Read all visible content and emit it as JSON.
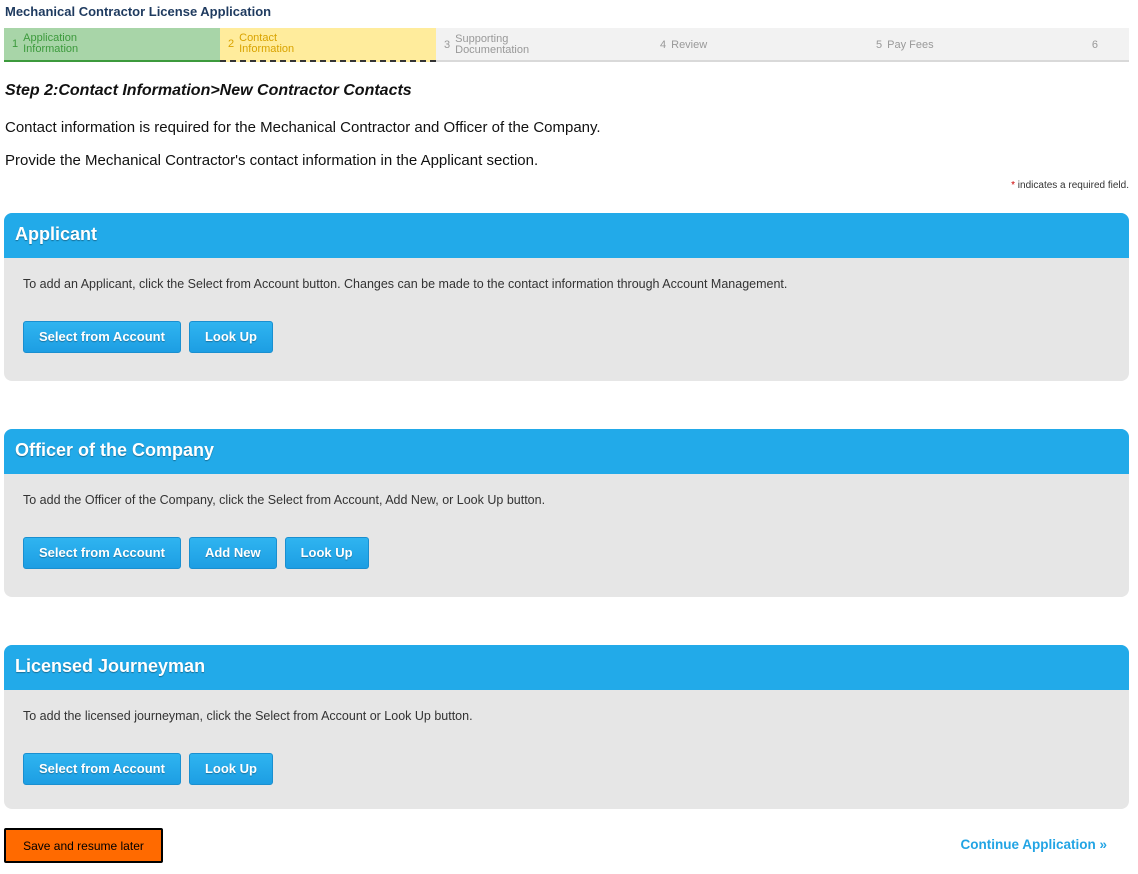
{
  "app": {
    "title": "Mechanical Contractor License Application"
  },
  "steps": [
    {
      "num": "1",
      "label_line1": "Application",
      "label_line2": "Information",
      "state": "done"
    },
    {
      "num": "2",
      "label_line1": "Contact",
      "label_line2": "Information",
      "state": "active"
    },
    {
      "num": "3",
      "label_line1": "Supporting",
      "label_line2": "Documentation",
      "state": "pending"
    },
    {
      "num": "4",
      "label_line1": "Review",
      "label_line2": "",
      "state": "pending"
    },
    {
      "num": "5",
      "label_line1": "Pay Fees",
      "label_line2": "",
      "state": "pending"
    },
    {
      "num": "6",
      "label_line1": "",
      "label_line2": "",
      "state": "pending"
    }
  ],
  "step_heading": "Step 2:Contact Information>New Contractor Contacts",
  "intro": {
    "line1": "Contact information is required for the Mechanical Contractor and Officer of the Company.",
    "line2": "Provide the Mechanical Contractor's contact information in the Applicant section."
  },
  "required_note": {
    "star": "*",
    "text": " indicates a required field."
  },
  "sections": {
    "applicant": {
      "title": "Applicant",
      "description": "To add an Applicant, click the Select from Account button. Changes can be made to the contact information through Account Management.",
      "select_label": "Select from Account",
      "lookup_label": "Look Up"
    },
    "officer": {
      "title": "Officer of the Company",
      "description": "To add the Officer of the Company, click the Select from Account, Add New, or Look Up button.",
      "select_label": "Select from Account",
      "add_new_label": "Add New",
      "lookup_label": "Look Up"
    },
    "journeyman": {
      "title": "Licensed Journeyman",
      "description": "To add the licensed journeyman, click the Select from Account or Look Up button.",
      "select_label": "Select from Account",
      "lookup_label": "Look Up"
    }
  },
  "footer": {
    "save_label": "Save and resume later",
    "continue_label": "Continue Application »"
  },
  "colors": {
    "section_header": "#22aae9",
    "section_body": "#e6e6e6",
    "save_button": "#ff6a00",
    "link": "#22a4e4",
    "step_done": "#a8d5a8",
    "step_active": "#ffec9c"
  }
}
